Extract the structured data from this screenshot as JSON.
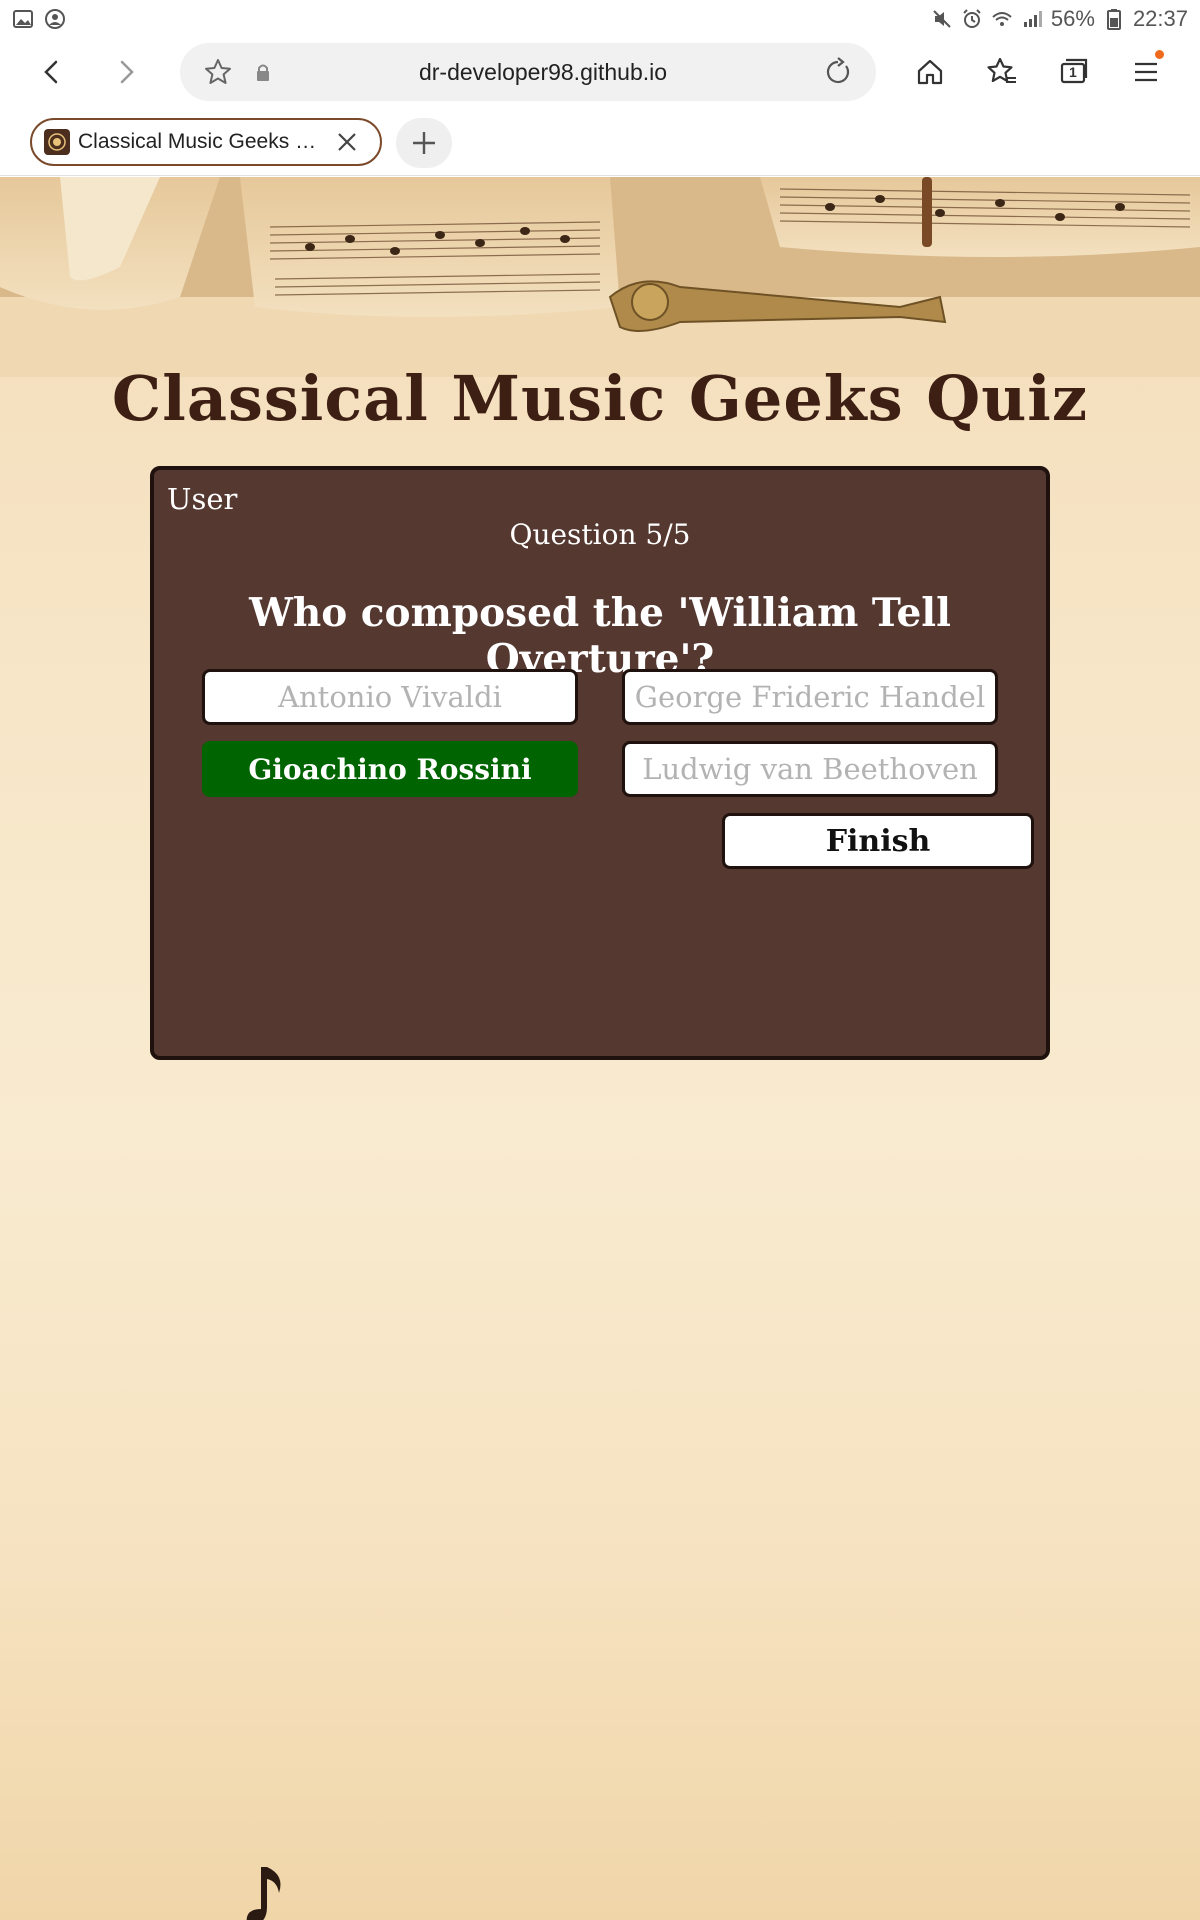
{
  "status_bar": {
    "battery_percent": "56%",
    "time": "22:37"
  },
  "browser": {
    "url": "dr-developer98.github.io",
    "tab_count": "1",
    "tabs": [
      {
        "title": "Classical Music Geeks Q..."
      }
    ]
  },
  "quiz": {
    "title": "Classical Music Geeks Quiz",
    "user_label": "User",
    "question_counter": "Question 5/5",
    "question": "Who composed the 'William Tell Overture'?",
    "answers": [
      {
        "label": "Antonio Vivaldi",
        "state": "disabled"
      },
      {
        "label": "George Frideric Handel",
        "state": "disabled"
      },
      {
        "label": "Gioachino Rossini",
        "state": "correct"
      },
      {
        "label": "Ludwig van Beethoven",
        "state": "disabled"
      }
    ],
    "finish_label": "Finish"
  },
  "colors": {
    "card_bg": "#553830",
    "title_color": "#3e1f14",
    "correct_answer": "#006400",
    "tab_border": "#7b4a2b",
    "notification_dot": "#f06a1c"
  }
}
